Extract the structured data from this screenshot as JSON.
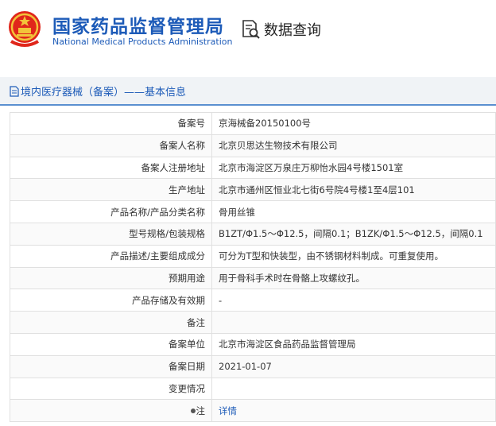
{
  "header": {
    "cn_title": "国家药品监督管理局",
    "en_title": "National Medical Products Administration",
    "query_label": "数据查询",
    "emblem_icon": "national-emblem-icon",
    "query_icon": "document-search-icon",
    "brand_color": "#1d5bb8"
  },
  "breadcrumb": {
    "icon": "document-icon",
    "text": "境内医疗器械（备案）——基本信息"
  },
  "rows": [
    {
      "label": "备案号",
      "value": "京海械备20150100号"
    },
    {
      "label": "备案人名称",
      "value": "北京贝思达生物技术有限公司"
    },
    {
      "label": "备案人注册地址",
      "value": "北京市海淀区万泉庄万柳怡水园4号楼1501室"
    },
    {
      "label": "生产地址",
      "value": "北京市通州区恒业北七街6号院4号楼1至4层101"
    },
    {
      "label": "产品名称/产品分类名称",
      "value": "骨用丝锥"
    },
    {
      "label": "型号规格/包装规格",
      "value": "B1ZT/Φ1.5～Φ12.5，间隔0.1；B1ZK/Φ1.5～Φ12.5，间隔0.1"
    },
    {
      "label": "产品描述/主要组成成分",
      "value": "可分为T型和快装型，由不锈钢材料制成。可重复使用。"
    },
    {
      "label": "预期用途",
      "value": "用于骨科手术时在骨骼上攻螺纹孔。"
    },
    {
      "label": "产品存储及有效期",
      "value": "-"
    },
    {
      "label": "备注",
      "value": ""
    },
    {
      "label": "备案单位",
      "value": "北京市海淀区食品药品监督管理局"
    },
    {
      "label": "备案日期",
      "value": "2021-01-07"
    },
    {
      "label": "变更情况",
      "value": ""
    }
  ],
  "note_row": {
    "icon": "bullet-icon",
    "label": "注",
    "link": "详情"
  }
}
